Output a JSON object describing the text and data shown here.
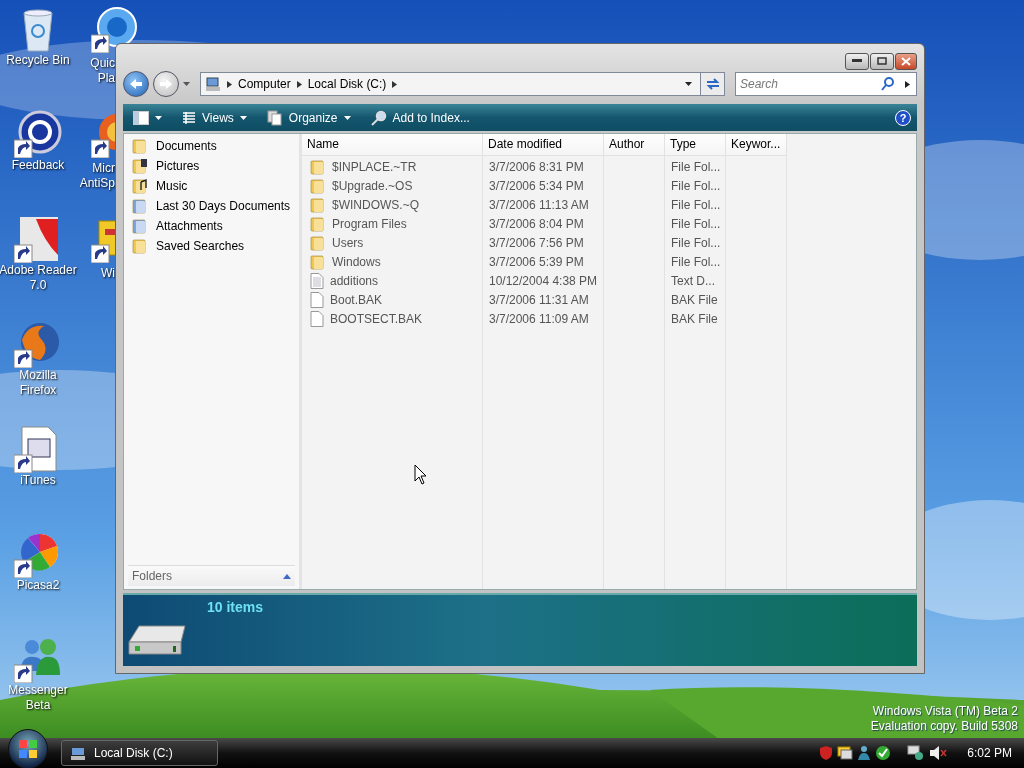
{
  "desktop_icons": [
    {
      "kind": "recycle",
      "lines": [
        "Recycle Bin"
      ]
    },
    {
      "kind": "help",
      "lines": [
        "Feedback"
      ]
    },
    {
      "kind": "pdf",
      "lines": [
        "Adobe Reader",
        "7.0"
      ]
    },
    {
      "kind": "browser",
      "lines": [
        "Mozilla",
        "Firefox"
      ]
    },
    {
      "kind": "document",
      "lines": [
        "iTunes"
      ]
    },
    {
      "kind": "pinwheel",
      "lines": [
        "Picasa2"
      ]
    },
    {
      "kind": "people",
      "lines": [
        "Messenger",
        "Beta"
      ]
    }
  ],
  "desktop_icons_partial": [
    {
      "kind": "player",
      "lines": [
        "Quic",
        "Pla"
      ]
    },
    {
      "kind": "shield",
      "lines": [
        "Micr",
        "AntiSp"
      ]
    },
    {
      "kind": "cabinet",
      "lines": [
        "Wi"
      ]
    }
  ],
  "window": {
    "address": {
      "crumbs": [
        "Computer",
        "Local Disk (C:)"
      ]
    },
    "search": {
      "placeholder": "Search"
    },
    "toolbar": [
      {
        "kind": "layout",
        "caret": true
      },
      {
        "kind": "views",
        "label": "Views",
        "caret": true
      },
      {
        "kind": "organize",
        "label": "Organize",
        "caret": true
      },
      {
        "kind": "index",
        "label": "Add to Index...",
        "caret": false
      }
    ],
    "help_button": "?",
    "nav_pane": {
      "items": [
        {
          "kind": "folder",
          "label": "Documents"
        },
        {
          "kind": "pictures",
          "label": "Pictures"
        },
        {
          "kind": "music",
          "label": "Music"
        },
        {
          "kind": "search",
          "label": "Last 30 Days Documents"
        },
        {
          "kind": "search",
          "label": "Attachments"
        },
        {
          "kind": "folder",
          "label": "Saved Searches"
        }
      ],
      "folders_bar": {
        "label": "Folders",
        "expanded": false
      }
    },
    "columns": [
      {
        "label": "Name"
      },
      {
        "label": "Date modified"
      },
      {
        "label": "Author"
      },
      {
        "label": "Type"
      },
      {
        "label": "Keywor..."
      }
    ],
    "rows": [
      {
        "kind": "folder",
        "name": "$INPLACE.~TR",
        "date_modified": "3/7/2006 8:31 PM",
        "type": "File Fol..."
      },
      {
        "kind": "folder",
        "name": "$Upgrade.~OS",
        "date_modified": "3/7/2006 5:34 PM",
        "type": "File Fol..."
      },
      {
        "kind": "folder",
        "name": "$WINDOWS.~Q",
        "date_modified": "3/7/2006 11:13 AM",
        "type": "File Fol..."
      },
      {
        "kind": "folder",
        "name": "Program Files",
        "date_modified": "3/7/2006 8:04 PM",
        "type": "File Fol..."
      },
      {
        "kind": "folder",
        "name": "Users",
        "date_modified": "3/7/2006 7:56 PM",
        "type": "File Fol..."
      },
      {
        "kind": "folder",
        "name": "Windows",
        "date_modified": "3/7/2006 5:39 PM",
        "type": "File Fol..."
      },
      {
        "kind": "text",
        "name": "additions",
        "date_modified": "10/12/2004 4:38 PM",
        "type": "Text D..."
      },
      {
        "kind": "file",
        "name": "Boot.BAK",
        "date_modified": "3/7/2006 11:31 AM",
        "type": "BAK File"
      },
      {
        "kind": "file",
        "name": "BOOTSECT.BAK",
        "date_modified": "3/7/2006 11:09 AM",
        "type": "BAK File"
      }
    ],
    "details": {
      "count": "10 items"
    }
  },
  "watermark_lines": [
    "Windows Vista (TM) Beta 2",
    "Evaluation copy. Build 5308"
  ],
  "taskbar": {
    "buttons": [
      {
        "label": "Local Disk (C:)"
      }
    ],
    "clock": "6:02 PM"
  }
}
